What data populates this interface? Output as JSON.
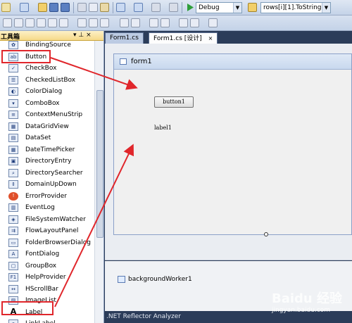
{
  "toolbar": {
    "config_select": "Debug",
    "find_combo": "rows[i][1].ToString("
  },
  "toolbox": {
    "title": "工具箱",
    "pin": "▾ ⊥ ×",
    "items": [
      {
        "label": "BindingSource",
        "icon": "binding-source-icon"
      },
      {
        "label": "Button",
        "icon": "button-icon"
      },
      {
        "label": "CheckBox",
        "icon": "checkbox-icon"
      },
      {
        "label": "CheckedListBox",
        "icon": "checked-list-box-icon"
      },
      {
        "label": "ColorDialog",
        "icon": "color-dialog-icon"
      },
      {
        "label": "ComboBox",
        "icon": "combobox-icon"
      },
      {
        "label": "ContextMenuStrip",
        "icon": "context-menu-strip-icon"
      },
      {
        "label": "DataGridView",
        "icon": "data-grid-view-icon"
      },
      {
        "label": "DataSet",
        "icon": "dataset-icon"
      },
      {
        "label": "DateTimePicker",
        "icon": "date-time-picker-icon"
      },
      {
        "label": "DirectoryEntry",
        "icon": "directory-entry-icon"
      },
      {
        "label": "DirectorySearcher",
        "icon": "directory-searcher-icon"
      },
      {
        "label": "DomainUpDown",
        "icon": "domain-up-down-icon"
      },
      {
        "label": "ErrorProvider",
        "icon": "error-provider-icon"
      },
      {
        "label": "EventLog",
        "icon": "event-log-icon"
      },
      {
        "label": "FileSystemWatcher",
        "icon": "file-system-watcher-icon"
      },
      {
        "label": "FlowLayoutPanel",
        "icon": "flow-layout-panel-icon"
      },
      {
        "label": "FolderBrowserDialog",
        "icon": "folder-browser-dialog-icon"
      },
      {
        "label": "FontDialog",
        "icon": "font-dialog-icon"
      },
      {
        "label": "GroupBox",
        "icon": "group-box-icon"
      },
      {
        "label": "HelpProvider",
        "icon": "help-provider-icon"
      },
      {
        "label": "HScrollBar",
        "icon": "hscrollbar-icon"
      },
      {
        "label": "ImageList",
        "icon": "image-list-icon"
      },
      {
        "label": "Label",
        "icon": "label-icon"
      },
      {
        "label": "LinkLabel",
        "icon": "link-label-icon"
      }
    ]
  },
  "tabs": [
    {
      "label": "Form1.cs",
      "active": false
    },
    {
      "label": "Form1.cs [设计]",
      "active": true,
      "close": "×"
    }
  ],
  "form": {
    "title": "form1",
    "button_text": "button1",
    "label_text": "label1"
  },
  "tray": {
    "component": "backgroundWorker1"
  },
  "status": {
    "text": ".NET Reflector Analyzer"
  },
  "watermark": {
    "logo": "Baidu 经验",
    "url": "jingyan.baidu.com"
  },
  "colors": {
    "annotation": "#e0262b",
    "accent": "#2b3c59"
  }
}
